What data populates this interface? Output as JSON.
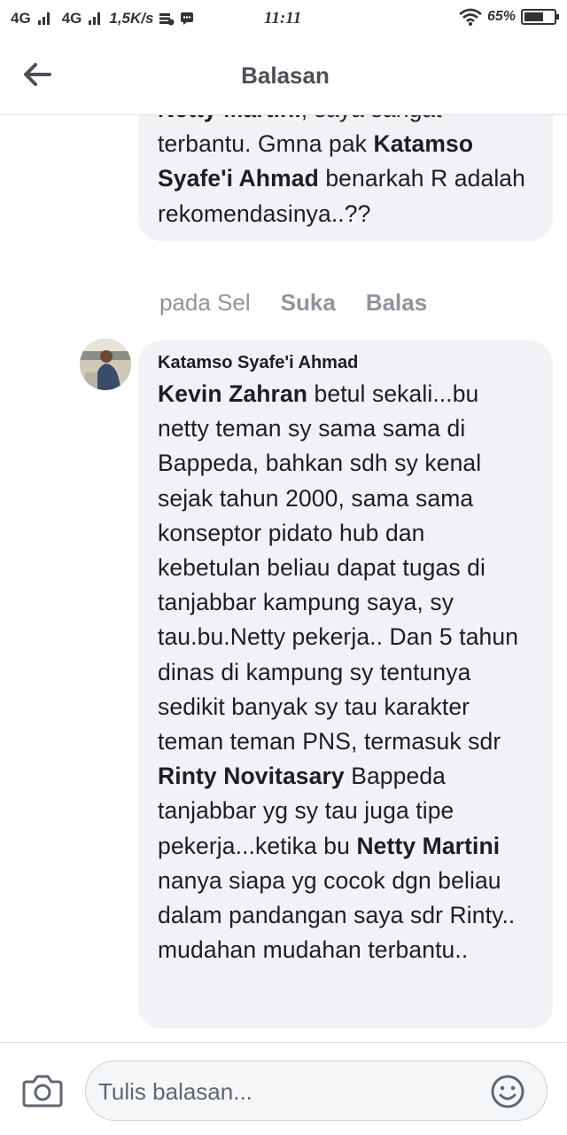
{
  "status_bar": {
    "network1": "4G",
    "network2": "4G",
    "speed": "1,5K/s",
    "time": "11:11",
    "battery_text": "65%",
    "battery_level": 0.65
  },
  "header": {
    "title": "Balasan"
  },
  "comment1": {
    "text_parts": [
      {
        "t": "Netty Martini",
        "bold": true
      },
      {
        "t": ", saya sangat terbantu. Gmna pak ",
        "bold": false
      },
      {
        "t": "Katamso Syafe'i Ahmad",
        "bold": true
      },
      {
        "t": " benarkah R adalah rekomendasinya..??",
        "bold": false
      }
    ],
    "actions": {
      "time": "pada Sel",
      "like": "Suka",
      "reply": "Balas"
    }
  },
  "comment2": {
    "author": "Katamso Syafe'i Ahmad",
    "mention1": "Kevin Zahran",
    "text1": " betul sekali...bu netty  teman sy sama sama di Bappeda, bahkan sdh sy kenal sejak tahun 2000, sama sama konseptor pidato hub dan kebetulan beliau dapat tugas di tanjabbar kampung saya, sy tau.bu.Netty pekerja.. Dan 5 tahun dinas di kampung sy tentunya sedikit banyak sy tau karakter teman teman PNS, termasuk sdr ",
    "mention2": "Rinty Novitasary",
    "text2": " Bappeda tanjabbar yg sy tau juga tipe pekerja...ketika bu ",
    "mention3": "Netty Martini",
    "text3": " nanya siapa yg cocok dgn beliau dalam pandangan saya sdr Rinty.. mudahan mudahan terbantu.."
  },
  "reply_bar": {
    "placeholder": "Tulis balasan..."
  },
  "icons": {
    "back": "arrow-left-icon",
    "camera": "camera-icon",
    "emoji": "smiley-icon"
  }
}
